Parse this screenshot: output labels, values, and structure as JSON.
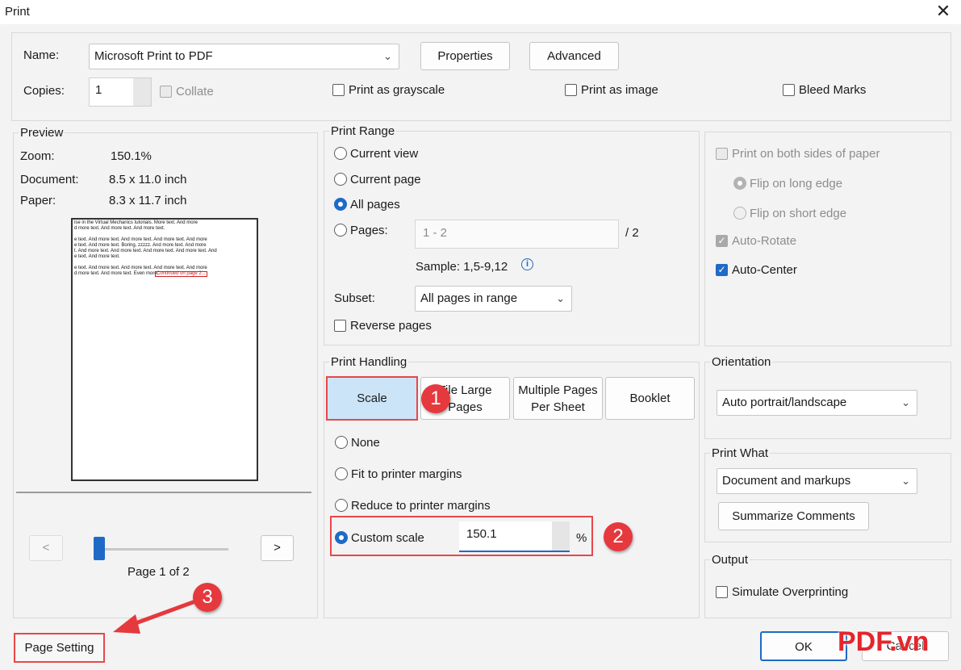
{
  "window": {
    "title": "Print",
    "close_glyph": "✕"
  },
  "printer": {
    "name_label": "Name:",
    "name_value": "Microsoft Print to PDF",
    "properties_label": "Properties",
    "advanced_label": "Advanced",
    "copies_label": "Copies:",
    "copies_value": "1",
    "collate_label": "Collate",
    "grayscale_label": "Print as grayscale",
    "image_label": "Print as image",
    "bleed_label": "Bleed Marks"
  },
  "preview": {
    "legend": "Preview",
    "zoom_label": "Zoom:",
    "zoom_value": "150.1%",
    "document_label": "Document:",
    "document_value": "8.5 x 11.0 inch",
    "paper_label": "Paper:",
    "paper_value": "8.3 x 11.7 inch",
    "doc_lines": [
      "ise in the Virtual Mechanics tutorials. More text. And more",
      "d more text. And more text. And more text.",
      "e text. And more text. And more text. And more text. And more",
      "e text. And more text. Boring, zzzzz. And more text. And more",
      "t. And more text. And more text. And more text. And more text. And",
      "e text. And more text.",
      "e text. And more text. And more text. And more text. And more",
      "d more text. And more text. Even more."
    ],
    "doc_link": "Continued on page 2...",
    "prev_label": "<",
    "next_label": ">",
    "page_label": "Page 1 of 2",
    "slider_value": 0
  },
  "print_range": {
    "legend": "Print Range",
    "current_view": "Current view",
    "current_page": "Current page",
    "all_pages": "All pages",
    "pages_label": "Pages:",
    "pages_placeholder": "1 - 2",
    "pages_total": "/ 2",
    "sample": "Sample: 1,5-9,12",
    "info_glyph": "i",
    "subset_label": "Subset:",
    "subset_value": "All pages in range",
    "reverse_label": "Reverse pages"
  },
  "duplex": {
    "both_sides": "Print on both sides of paper",
    "flip_long": "Flip on long edge",
    "flip_short": "Flip on short edge",
    "auto_rotate": "Auto-Rotate",
    "auto_center": "Auto-Center"
  },
  "handling": {
    "legend": "Print Handling",
    "scale_label": "Scale",
    "tile_label": "Tile Large Pages",
    "multiple_label": "Multiple Pages Per Sheet",
    "booklet_label": "Booklet",
    "none": "None",
    "fit": "Fit to printer margins",
    "reduce": "Reduce to printer margins",
    "custom": "Custom scale",
    "custom_value": "150.1",
    "percent": "%"
  },
  "orientation": {
    "legend": "Orientation",
    "value": "Auto portrait/landscape"
  },
  "print_what": {
    "legend": "Print What",
    "value": "Document and markups",
    "summarize_label": "Summarize Comments"
  },
  "output": {
    "legend": "Output",
    "simulate_label": "Simulate Overprinting"
  },
  "footer": {
    "page_setting_label": "Page Setting",
    "ok_label": "OK",
    "cancel_label": "Cancel"
  },
  "annotations": {
    "badge1": "1",
    "badge2": "2",
    "badge3": "3",
    "accent": "#e5393e"
  },
  "watermark": {
    "brand": "PDF",
    "suffix": ".vn",
    "color": "#e5252b"
  }
}
